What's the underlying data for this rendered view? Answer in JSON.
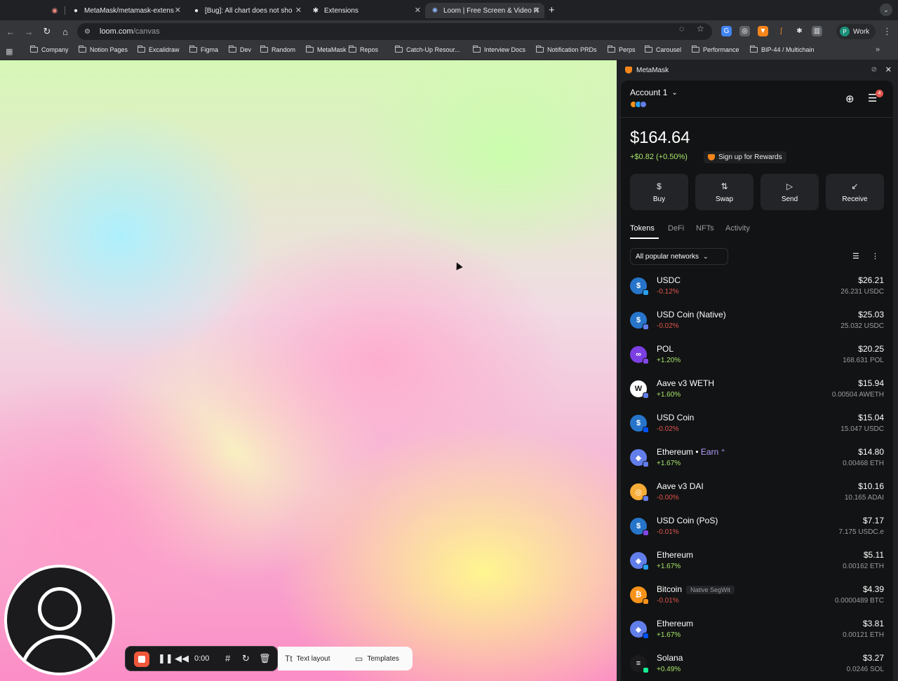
{
  "tabs": [
    {
      "title": "MetaMask/metamask-extens",
      "icon": "github-icon"
    },
    {
      "title": "[Bug]: All chart does not sho",
      "icon": "github-icon"
    },
    {
      "title": "Extensions",
      "icon": "puzzle-icon"
    },
    {
      "title": "Loom | Free Screen & Video R",
      "icon": "loom-icon",
      "active": true
    }
  ],
  "address_bar": {
    "host": "loom.com",
    "path": "/canvas"
  },
  "profile": {
    "initial": "P",
    "label": "Work"
  },
  "bookmarks": [
    "Company",
    "Notion Pages",
    "Excalidraw",
    "Figma",
    "Dev",
    "Random",
    "MetaMask",
    "Repos",
    "Catch-Up Resour...",
    "Interview Docs",
    "Notification PRDs",
    "Perps",
    "Carousel",
    "Performance",
    "BIP-44 / Multichain"
  ],
  "recorder": {
    "time": "0:00",
    "text_layout_label": "Text layout",
    "templates_label": "Templates"
  },
  "side_panel": {
    "title": "MetaMask"
  },
  "metamask": {
    "account_name": "Account 1",
    "notification_count": "4",
    "balance": "$164.64",
    "change": "+$0.82 (+0.50%)",
    "rewards_label": "Sign up for Rewards",
    "actions": [
      "Buy",
      "Swap",
      "Send",
      "Receive"
    ],
    "tabs": [
      "Tokens",
      "DeFi",
      "NFTs",
      "Activity"
    ],
    "network_filter": "All popular networks",
    "tokens": [
      {
        "name": "USDC",
        "change": "-0.12%",
        "fiat": "$26.21",
        "amount": "26.231 USDC",
        "dir": "neg",
        "color": "#2775ca",
        "chain_color": "#28a0f0",
        "glyph": "$"
      },
      {
        "name": "USD Coin (Native)",
        "change": "-0.02%",
        "fiat": "$25.03",
        "amount": "25.032 USDC",
        "dir": "neg",
        "color": "#2775ca",
        "chain_color": "#627eea",
        "glyph": "$"
      },
      {
        "name": "POL",
        "change": "+1.20%",
        "fiat": "$20.25",
        "amount": "168.631 POL",
        "dir": "pos",
        "color": "#7b3fe4",
        "chain_color": "#8247e5",
        "glyph": "∞"
      },
      {
        "name": "Aave v3 WETH",
        "change": "+1.60%",
        "fiat": "$15.94",
        "amount": "0.00504 AWETH",
        "dir": "pos",
        "color": "#ffffff",
        "chain_color": "#627eea",
        "glyph": "W"
      },
      {
        "name": "USD Coin",
        "change": "-0.02%",
        "fiat": "$15.04",
        "amount": "15.047 USDC",
        "dir": "neg",
        "color": "#2775ca",
        "chain_color": "#0052ff",
        "glyph": "$"
      },
      {
        "name": "Ethereum",
        "earn": "Earn",
        "change": "+1.67%",
        "fiat": "$14.80",
        "amount": "0.00468 ETH",
        "dir": "pos",
        "color": "#627eea",
        "chain_color": "#627eea",
        "glyph": "◆"
      },
      {
        "name": "Aave v3 DAI",
        "change": "-0.00%",
        "fiat": "$10.16",
        "amount": "10.165 ADAI",
        "dir": "neg",
        "color": "#f5ac37",
        "chain_color": "#627eea",
        "glyph": "◎"
      },
      {
        "name": "USD Coin (PoS)",
        "change": "-0.01%",
        "fiat": "$7.17",
        "amount": "7.175 USDC.e",
        "dir": "neg",
        "color": "#2775ca",
        "chain_color": "#8247e5",
        "glyph": "$"
      },
      {
        "name": "Ethereum",
        "change": "+1.67%",
        "fiat": "$5.11",
        "amount": "0.00162 ETH",
        "dir": "pos",
        "color": "#627eea",
        "chain_color": "#28a0f0",
        "glyph": "◆"
      },
      {
        "name": "Bitcoin",
        "tag": "Native SegWit",
        "change": "-0.01%",
        "fiat": "$4.39",
        "amount": "0.0000489 BTC",
        "dir": "neg",
        "color": "#f7931a",
        "chain_color": "#f7931a",
        "glyph": "₿"
      },
      {
        "name": "Ethereum",
        "change": "+1.67%",
        "fiat": "$3.81",
        "amount": "0.00121 ETH",
        "dir": "pos",
        "color": "#627eea",
        "chain_color": "#0052ff",
        "glyph": "◆"
      },
      {
        "name": "Solana",
        "change": "+0.49%",
        "fiat": "$3.27",
        "amount": "0.0246 SOL",
        "dir": "pos",
        "color": "#1b1b1d",
        "chain_color": "#14f195",
        "glyph": "≡"
      }
    ]
  }
}
